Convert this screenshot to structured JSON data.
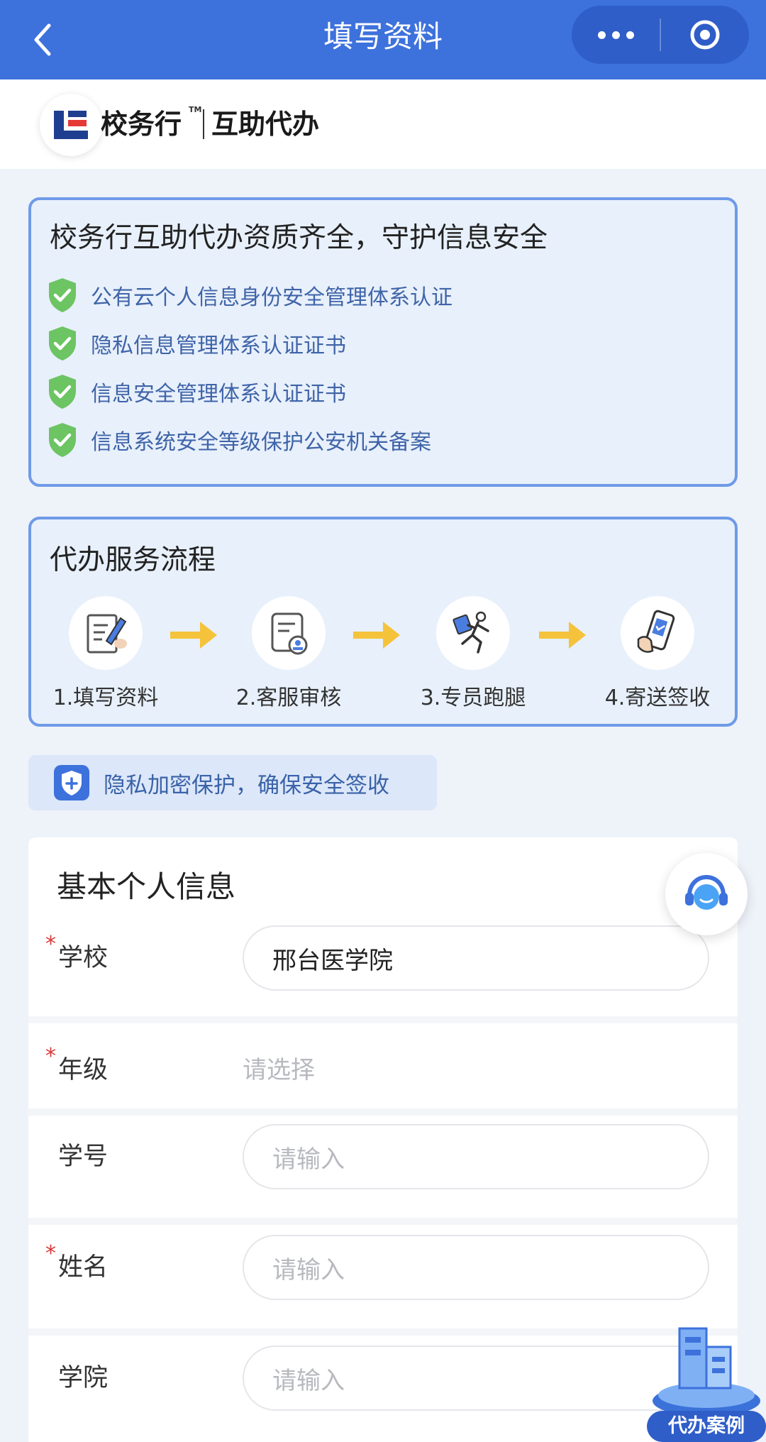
{
  "nav": {
    "title": "填写资料"
  },
  "brand": {
    "name": "校务行",
    "tm": "TM",
    "sub": "互助代办"
  },
  "cert": {
    "title": "校务行互助代办资质齐全，守护信息安全",
    "items": [
      "公有云个人信息身份安全管理体系认证",
      "隐私信息管理体系认证证书",
      "信息安全管理体系认证证书",
      "信息系统安全等级保护公安机关备案"
    ]
  },
  "flow": {
    "title": "代办服务流程",
    "steps": [
      "1.填写资料",
      "2.客服审核",
      "3.专员跑腿",
      "4.寄送签收"
    ]
  },
  "privacy": {
    "text": "隐私加密保护，确保安全签收"
  },
  "form": {
    "title": "基本个人信息",
    "required_mark": "*",
    "school": {
      "label": "学校",
      "value": "邢台医学院"
    },
    "grade": {
      "label": "年级",
      "placeholder": "请选择"
    },
    "student_id": {
      "label": "学号",
      "placeholder": "请输入"
    },
    "name": {
      "label": "姓名",
      "placeholder": "请输入"
    },
    "college": {
      "label": "学院",
      "placeholder": "请输入"
    }
  },
  "float": {
    "case_label": "代办案例"
  },
  "colors": {
    "nav": "#3d71dc",
    "accent": "#6f9ae8",
    "shield": "#6cc463",
    "arrow": "#f5c33b"
  },
  "icons": [
    "back-arrow-icon",
    "more-dots-icon",
    "target-icon",
    "brand-logo-icon",
    "shield-check-icon",
    "fill-form-icon",
    "review-document-icon",
    "runner-icon",
    "phone-sign-icon",
    "arrow-right-icon",
    "plus-shield-icon",
    "headset-icon",
    "case-building-icon"
  ]
}
